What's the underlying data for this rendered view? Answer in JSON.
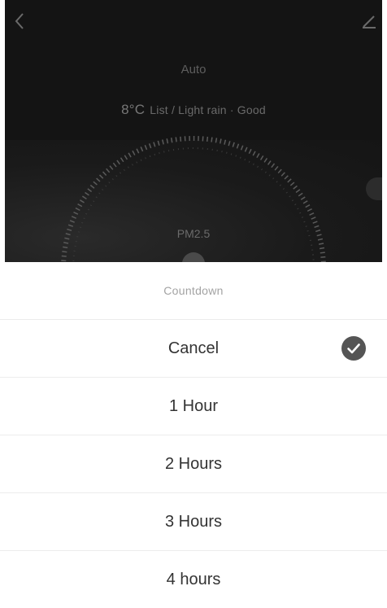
{
  "app": {
    "mode_label": "Auto",
    "weather_temp": "8°C",
    "weather_text": "List / Light rain · Good",
    "pm_label": "PM2.5"
  },
  "sheet": {
    "title": "Countdown",
    "options": [
      {
        "label": "Cancel",
        "selected": true
      },
      {
        "label": "1 Hour",
        "selected": false
      },
      {
        "label": "2 Hours",
        "selected": false
      },
      {
        "label": "3 Hours",
        "selected": false
      },
      {
        "label": "4 hours",
        "selected": false
      }
    ]
  },
  "icons": {
    "back": "chevron-left-icon",
    "edit": "pencil-icon",
    "check": "check-circle-icon"
  },
  "colors": {
    "app_background": "#141414",
    "sheet_background": "#ffffff",
    "check_fill": "#555555",
    "divider": "#ececec",
    "title_text": "#a3a3a3",
    "option_text": "#333333"
  }
}
